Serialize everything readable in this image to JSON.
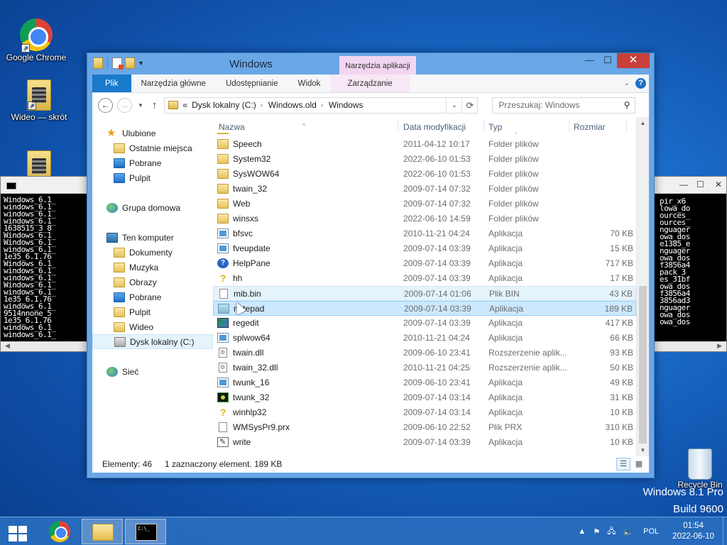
{
  "desktop": {
    "icons": [
      {
        "label": "Google Chrome"
      },
      {
        "label": "Wideo — skrót"
      },
      {
        "label": "Recycle Bin"
      }
    ],
    "watermark": {
      "line1": "Windows 8.1 Pro",
      "line2": "Build 9600"
    }
  },
  "window": {
    "title": "Windows",
    "context_tab_header": "Narzędzia aplikacji",
    "caption": {
      "minimize": "—",
      "maximize": "☐",
      "close": "✕"
    },
    "ribbon_tabs": [
      "Plik",
      "Narzędzia główne",
      "Udostępnianie",
      "Widok",
      "Zarządzanie"
    ],
    "address": {
      "prefix": "«",
      "crumbs": [
        "Dysk lokalny (C:)",
        "Windows.old",
        "Windows"
      ]
    },
    "search_placeholder": "Przeszukaj: Windows",
    "columns": {
      "name": "Nazwa",
      "date": "Data modyfikacji",
      "type": "Typ",
      "size": "Rozmiar"
    },
    "nav": {
      "favorites": "Ulubione",
      "fav_items": [
        "Ostatnie miejsca",
        "Pobrane",
        "Pulpit"
      ],
      "homegroup": "Grupa domowa",
      "computer": "Ten komputer",
      "computer_items": [
        "Dokumenty",
        "Muzyka",
        "Obrazy",
        "Pobrane",
        "Pulpit",
        "Wideo",
        "Dysk lokalny (C:)"
      ],
      "network": "Sieć"
    },
    "files": [
      {
        "name": "ShellNew",
        "date": "2011-04-12 10:28",
        "type": "Folder plików",
        "size": "",
        "icon": "folder"
      },
      {
        "name": "Speech",
        "date": "2011-04-12 10:17",
        "type": "Folder plików",
        "size": "",
        "icon": "folder"
      },
      {
        "name": "System32",
        "date": "2022-06-10 01:53",
        "type": "Folder plików",
        "size": "",
        "icon": "folder"
      },
      {
        "name": "SysWOW64",
        "date": "2022-06-10 01:53",
        "type": "Folder plików",
        "size": "",
        "icon": "folder"
      },
      {
        "name": "twain_32",
        "date": "2009-07-14 07:32",
        "type": "Folder plików",
        "size": "",
        "icon": "folder"
      },
      {
        "name": "Web",
        "date": "2009-07-14 07:32",
        "type": "Folder plików",
        "size": "",
        "icon": "folder"
      },
      {
        "name": "winsxs",
        "date": "2022-06-10 14:59",
        "type": "Folder plików",
        "size": "",
        "icon": "folder"
      },
      {
        "name": "bfsvc",
        "date": "2010-11-21 04:24",
        "type": "Aplikacja",
        "size": "70 KB",
        "icon": "app"
      },
      {
        "name": "fveupdate",
        "date": "2009-07-14 03:39",
        "type": "Aplikacja",
        "size": "15 KB",
        "icon": "app"
      },
      {
        "name": "HelpPane",
        "date": "2009-07-14 03:39",
        "type": "Aplikacja",
        "size": "717 KB",
        "icon": "help"
      },
      {
        "name": "hh",
        "date": "2009-07-14 03:39",
        "type": "Aplikacja",
        "size": "17 KB",
        "icon": "question"
      },
      {
        "name": "mib.bin",
        "date": "2009-07-14 01:06",
        "type": "Plik BIN",
        "size": "43 KB",
        "icon": "file"
      },
      {
        "name": "notepad",
        "date": "2009-07-14 03:39",
        "type": "Aplikacja",
        "size": "189 KB",
        "icon": "notepad"
      },
      {
        "name": "regedit",
        "date": "2009-07-14 03:39",
        "type": "Aplikacja",
        "size": "417 KB",
        "icon": "regedit"
      },
      {
        "name": "splwow64",
        "date": "2010-11-21 04:24",
        "type": "Aplikacja",
        "size": "66 KB",
        "icon": "app"
      },
      {
        "name": "twain.dll",
        "date": "2009-06-10 23:41",
        "type": "Rozszerzenie aplik...",
        "size": "93 KB",
        "icon": "dll"
      },
      {
        "name": "twain_32.dll",
        "date": "2010-11-21 04:25",
        "type": "Rozszerzenie aplik...",
        "size": "50 KB",
        "icon": "dll"
      },
      {
        "name": "twunk_16",
        "date": "2009-06-10 23:41",
        "type": "Aplikacja",
        "size": "49 KB",
        "icon": "app"
      },
      {
        "name": "twunk_32",
        "date": "2009-07-14 03:14",
        "type": "Aplikacja",
        "size": "31 KB",
        "icon": "twunk"
      },
      {
        "name": "winhlp32",
        "date": "2009-07-14 03:14",
        "type": "Aplikacja",
        "size": "10 KB",
        "icon": "question"
      },
      {
        "name": "WMSysPr9.prx",
        "date": "2009-06-10 22:52",
        "type": "Plik PRX",
        "size": "310 KB",
        "icon": "file"
      },
      {
        "name": "write",
        "date": "2009-07-14 03:39",
        "type": "Aplikacja",
        "size": "10 KB",
        "icon": "write"
      }
    ],
    "status": {
      "count": "Elementy: 46",
      "selection": "1 zaznaczony element. 189 KB"
    }
  },
  "cmd_left_text": "Windows_6.1_\nwindows_6.1_\nwindows_6.1_\nwindows_6.1_\n1638515_3_8\nWindows_6.1_\nWindows_6.1_\nwindows_6.1_\n1e35_6.1.76\nWindows_6.1_\nwindows_6.1_\nwindows_6.1_\nWindows_6.1_\nwindows_6.1_\n1e35_6.1.76\nwindows_6.1_\n9514nnone_5\n1e35_6.1.76\nwindows_6.1_\nwindows_6.1_",
  "cmd_right_text": "pir_x6\nlowa_do\nources_\nources_\nnguager\nowa_dos\ne1385_e\nnguager\nowa_dos\nf3856a4\npack_3\nes_31bf\nowa_dos\nf3856a4\n3856ad3\nnguager\nowa_dos\nowa_dos",
  "taskbar": {
    "language": "POL",
    "time": "01:54",
    "date": "2022-06-10"
  }
}
